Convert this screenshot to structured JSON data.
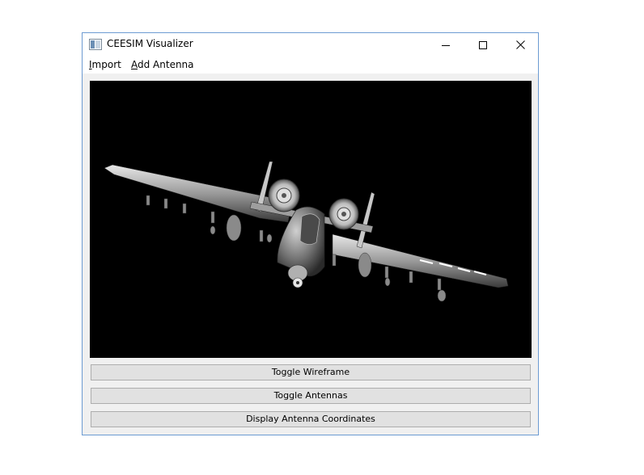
{
  "window": {
    "title": "CEESIM Visualizer",
    "controls": {
      "minimize_icon": "minimize-icon",
      "maximize_icon": "maximize-icon",
      "close_icon": "close-icon"
    }
  },
  "menubar": {
    "items": [
      {
        "mnemonic": "I",
        "rest": "mport"
      },
      {
        "mnemonic": "A",
        "rest": "dd Antenna"
      }
    ]
  },
  "viewport": {
    "content": "aircraft-3d-render",
    "background": "#000000"
  },
  "buttons": {
    "toggle_wireframe": "Toggle Wireframe",
    "toggle_antennas": "Toggle Antennas",
    "display_antenna_coordinates": "Display Antenna Coordinates"
  },
  "colors": {
    "window_border": "#6c9bd2",
    "client_bg": "#f0f0f0",
    "button_bg": "#e1e1e1"
  }
}
